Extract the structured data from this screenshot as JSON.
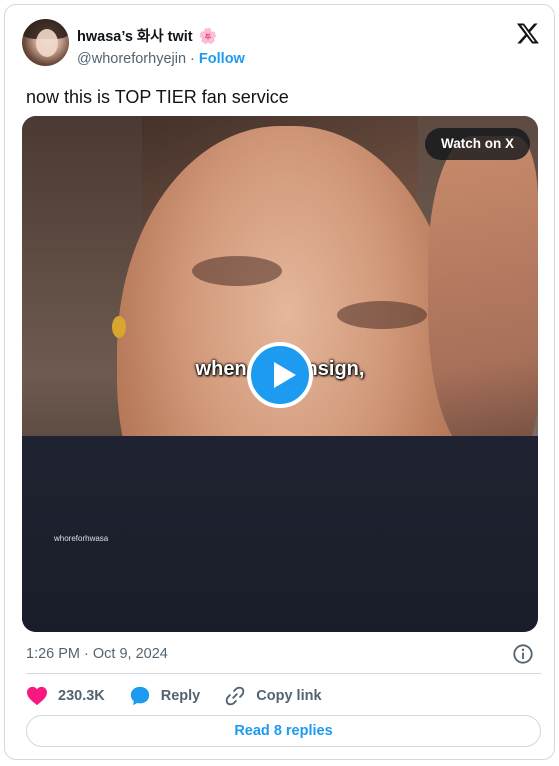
{
  "author": {
    "display_name": "hwasa’s 화사 twit",
    "flower_emoji": "🌸",
    "handle": "@whoreforhyejin",
    "separator": " · ",
    "follow_label": "Follow"
  },
  "tweet": {
    "text": "now this is TOP TIER fan service"
  },
  "media": {
    "watch_label": "Watch on X",
    "caption": "when the        fansign,",
    "watermark": "whoreforhwasa"
  },
  "meta": {
    "timestamp": "1:26 PM · Oct 9, 2024"
  },
  "actions": {
    "like_count": "230.3K",
    "reply_label": "Reply",
    "copy_link_label": "Copy link"
  },
  "read_replies_label": "Read 8 replies",
  "colors": {
    "accent": "#1d9bf0",
    "like": "#f91880",
    "text": "#0f1419",
    "muted": "#536471",
    "border": "#cfd9de"
  }
}
